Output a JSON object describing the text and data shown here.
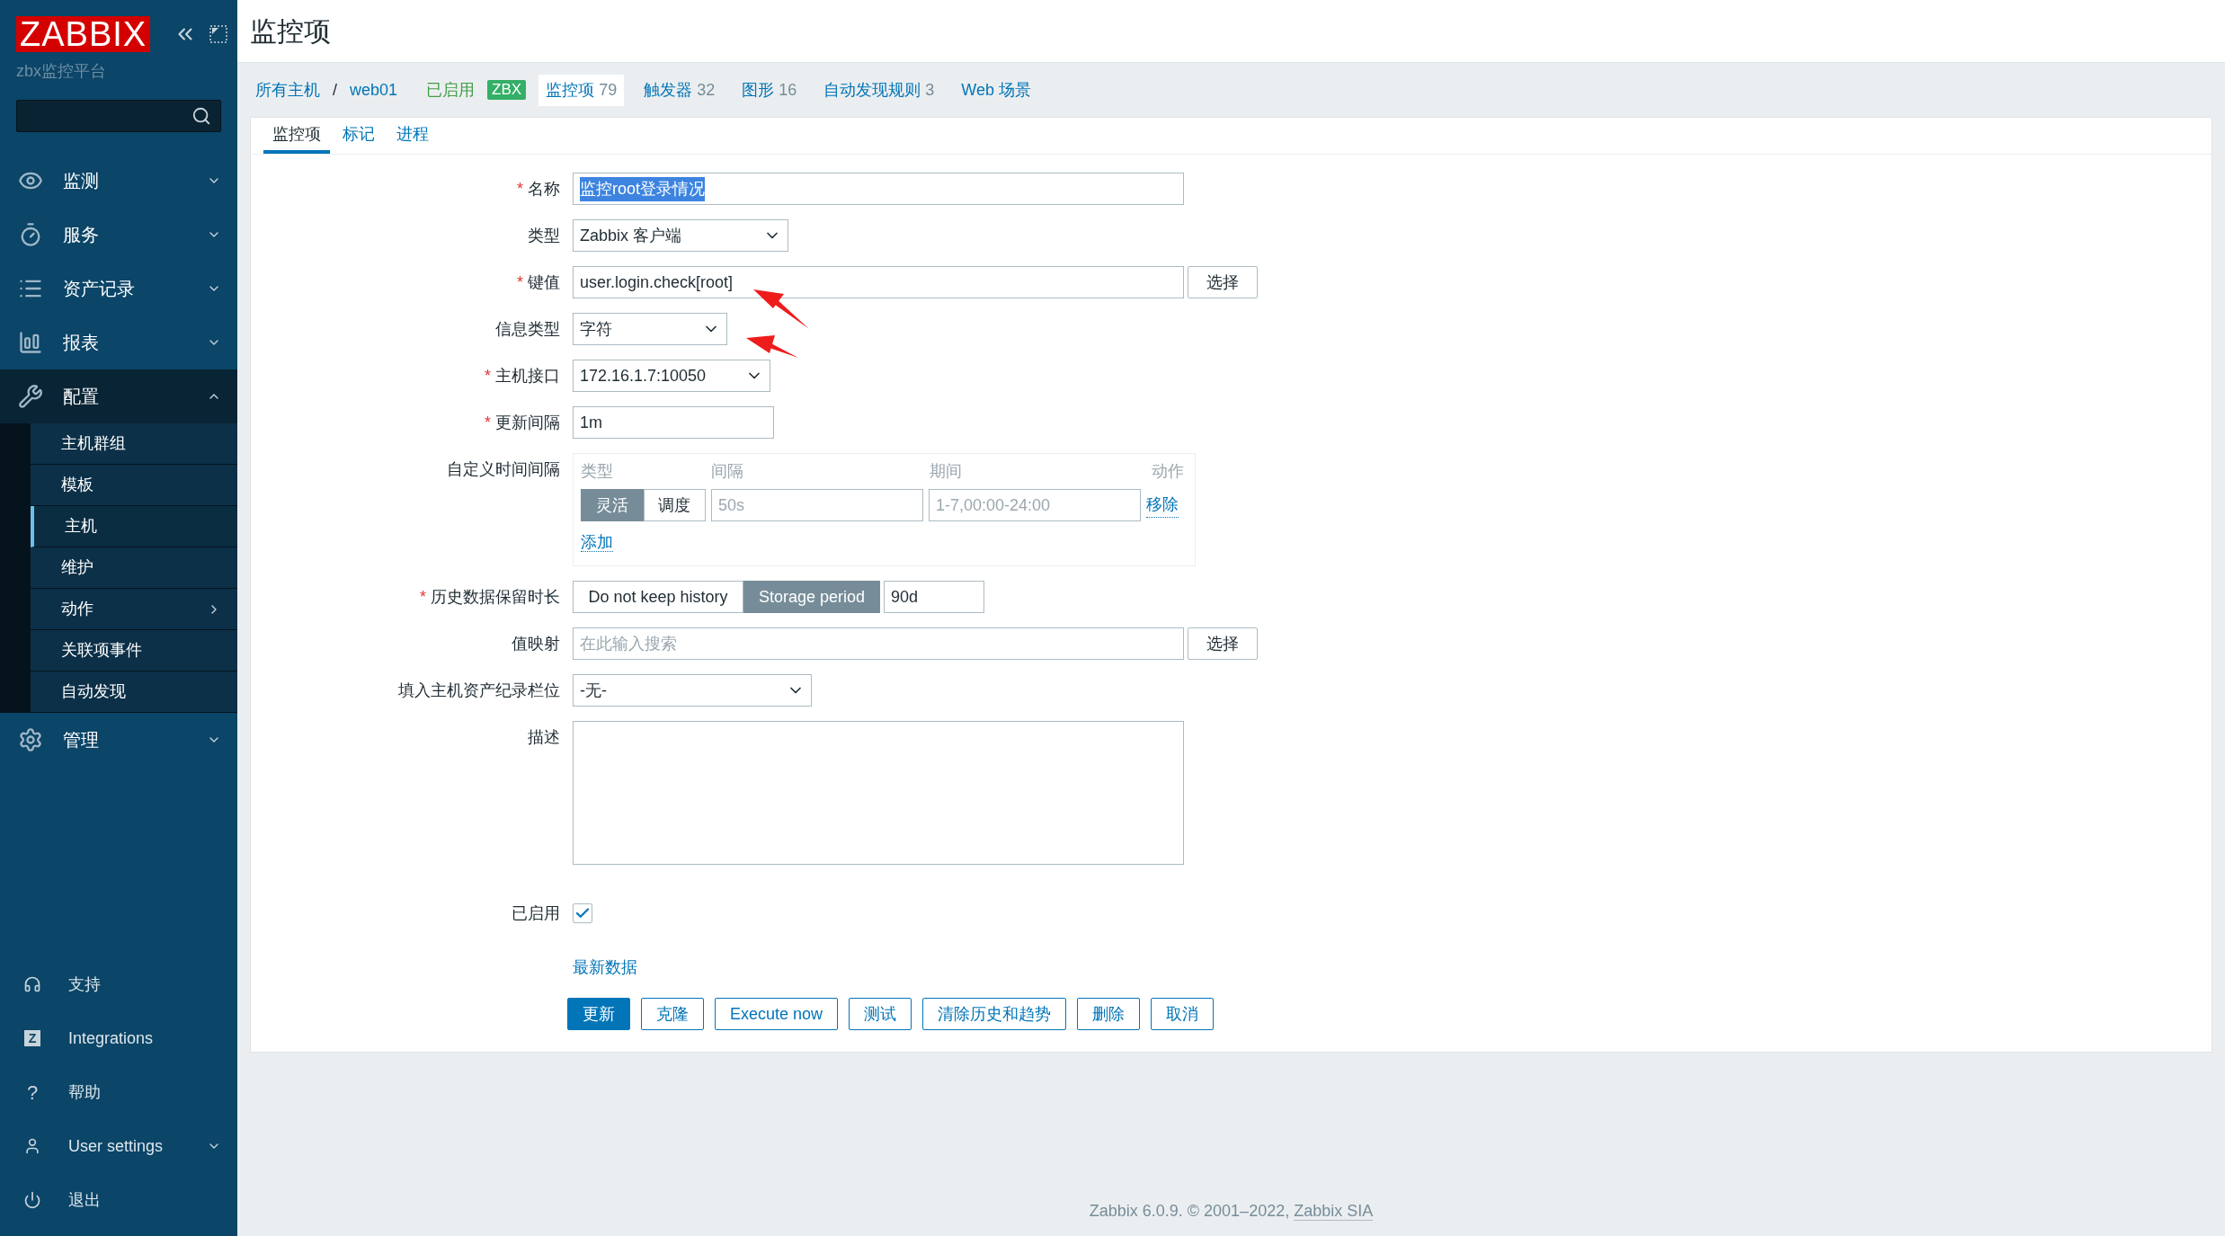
{
  "sidebar": {
    "logo": "ZABBIX",
    "subtitle": "zbx监控平台",
    "menu": [
      {
        "label": "监测",
        "expanded": false
      },
      {
        "label": "服务",
        "expanded": false
      },
      {
        "label": "资产记录",
        "expanded": false
      },
      {
        "label": "报表",
        "expanded": false
      },
      {
        "label": "配置",
        "expanded": true,
        "children": [
          {
            "label": "主机群组",
            "selected": false,
            "has_submenu": false
          },
          {
            "label": "模板",
            "selected": false,
            "has_submenu": false
          },
          {
            "label": "主机",
            "selected": true,
            "has_submenu": false
          },
          {
            "label": "维护",
            "selected": false,
            "has_submenu": false
          },
          {
            "label": "动作",
            "selected": false,
            "has_submenu": true
          },
          {
            "label": "关联项事件",
            "selected": false,
            "has_submenu": false
          },
          {
            "label": "自动发现",
            "selected": false,
            "has_submenu": false
          }
        ]
      },
      {
        "label": "管理",
        "expanded": false
      }
    ],
    "bottom": [
      {
        "label": "支持",
        "kind": "link"
      },
      {
        "label": "Integrations",
        "kind": "link",
        "glyph": "Z"
      },
      {
        "label": "帮助",
        "kind": "link",
        "glyph": "?"
      },
      {
        "label": "User settings",
        "kind": "menu"
      },
      {
        "label": "退出",
        "kind": "link"
      }
    ]
  },
  "header": {
    "title": "监控项"
  },
  "host_nav": {
    "breadcrumbs": [
      "所有主机",
      "web01"
    ],
    "separator": "/",
    "status": "已启用",
    "badge": "ZBX",
    "links": [
      {
        "label": "监控项",
        "count": "79",
        "selected": true
      },
      {
        "label": "触发器",
        "count": "32",
        "selected": false
      },
      {
        "label": "图形",
        "count": "16",
        "selected": false
      },
      {
        "label": "自动发现规则",
        "count": "3",
        "selected": false
      },
      {
        "label": "Web 场景",
        "selected": false
      }
    ]
  },
  "tabs": [
    {
      "label": "监控项",
      "selected": true
    },
    {
      "label": "标记",
      "selected": false
    },
    {
      "label": "进程",
      "selected": false
    }
  ],
  "required_mark": "*",
  "fields": [
    {
      "kind": "text",
      "label": "名称",
      "required": true,
      "value": "监控root登录情况",
      "highlighted": true
    },
    {
      "kind": "select",
      "label": "类型",
      "required": false,
      "value": "Zabbix 客户端"
    },
    {
      "kind": "picker",
      "label": "键值",
      "required": true,
      "value": "user.login.check[root]",
      "button": "选择"
    },
    {
      "kind": "select",
      "label": "信息类型",
      "required": false,
      "value": "字符"
    },
    {
      "kind": "select",
      "label": "主机接口",
      "required": true,
      "value": "172.16.1.7:10050"
    },
    {
      "kind": "text",
      "label": "更新间隔",
      "required": true,
      "value": "1m",
      "highlighted": false
    },
    {
      "kind": "intervals",
      "label": "自定义时间间隔",
      "required": false,
      "columns": [
        "类型",
        "间隔",
        "期间",
        "动作"
      ],
      "rows": [
        {
          "modes": [
            {
              "label": "灵活",
              "selected": true
            },
            {
              "label": "调度",
              "selected": false
            }
          ],
          "interval_placeholder": "50s",
          "period_placeholder": "1-7,00:00-24:00",
          "remove": "移除"
        }
      ],
      "add": "添加"
    },
    {
      "kind": "history",
      "label": "历史数据保留时长",
      "required": true,
      "modes": [
        {
          "label": "Do not keep history",
          "selected": false
        },
        {
          "label": "Storage period",
          "selected": true
        }
      ],
      "value": "90d"
    },
    {
      "kind": "picker",
      "label": "值映射",
      "required": false,
      "placeholder": "在此输入搜索",
      "button": "选择"
    },
    {
      "kind": "select",
      "label": "填入主机资产纪录栏位",
      "required": false,
      "value": "-无-"
    },
    {
      "kind": "textarea",
      "label": "描述",
      "required": false
    },
    {
      "kind": "checkbox",
      "label": "已启用",
      "required": false,
      "checked": true
    },
    {
      "kind": "link",
      "link": "最新数据"
    }
  ],
  "buttons": [
    {
      "label": "更新",
      "primary": true
    },
    {
      "label": "克隆",
      "primary": false
    },
    {
      "label": "Execute now",
      "primary": false
    },
    {
      "label": "测试",
      "primary": false
    },
    {
      "label": "清除历史和趋势",
      "primary": false
    },
    {
      "label": "删除",
      "primary": false
    },
    {
      "label": "取消",
      "primary": false
    }
  ],
  "footer": {
    "text": "Zabbix 6.0.9. © 2001–2022, ",
    "link": "Zabbix SIA"
  }
}
